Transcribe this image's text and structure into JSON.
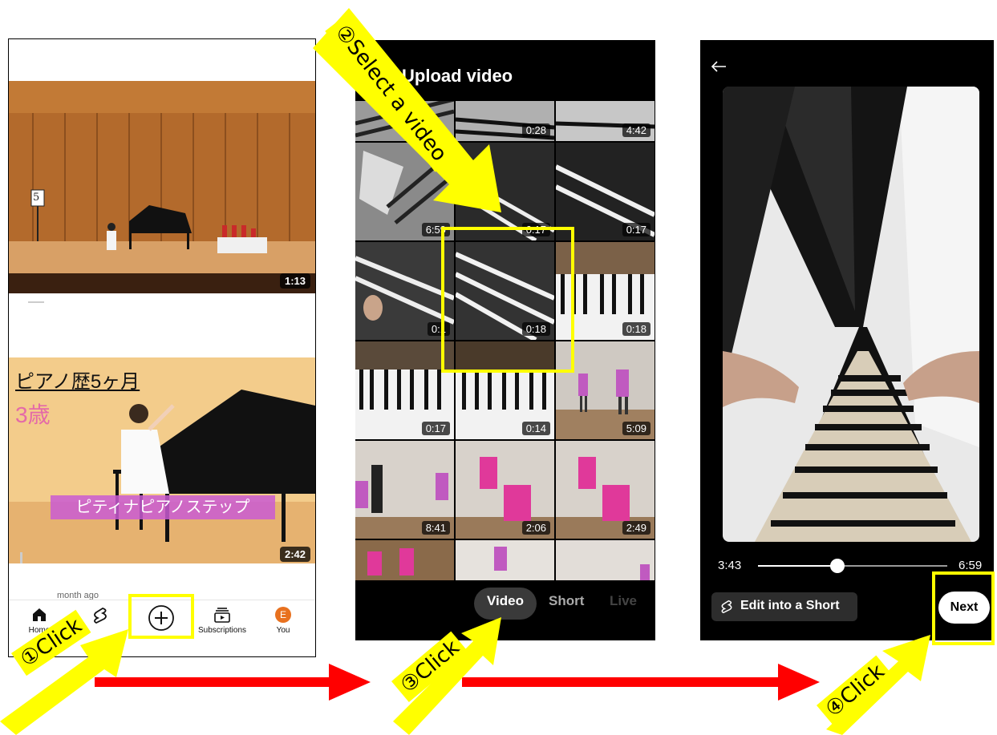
{
  "phone1": {
    "videos": [
      {
        "duration": "1:13",
        "stage_number": "5"
      },
      {
        "title_jp": "ピアノ歴5ヶ月",
        "age_jp": "3歳",
        "banner_jp": "ピティナピアノステップ",
        "duration": "2:42"
      }
    ],
    "partial_text": "month ago",
    "nav": {
      "home": "Home",
      "subscriptions": "Subscriptions",
      "you": "You",
      "avatar_letter": "E"
    }
  },
  "phone2": {
    "title": "Upload video",
    "durations": [
      "0:28",
      "4:42",
      "6:59",
      "0:17",
      "0:17",
      "0:1",
      "0:18",
      "0:18",
      "0:17",
      "0:14",
      "5:09",
      "8:41",
      "2:06",
      "2:49"
    ],
    "tabs": {
      "video": "Video",
      "short": "Short",
      "live": "Live"
    }
  },
  "phone3": {
    "current_time": "3:43",
    "total_time": "6:59",
    "edit_label": "Edit into a Short",
    "next_label": "Next",
    "scrub_progress": 0.42
  },
  "callouts": {
    "step1": "①Click",
    "step2": "②Select a video",
    "step3": "③Click",
    "step4": "④Click"
  },
  "colors": {
    "highlight": "#ffff00",
    "arrow": "#ff0000"
  }
}
